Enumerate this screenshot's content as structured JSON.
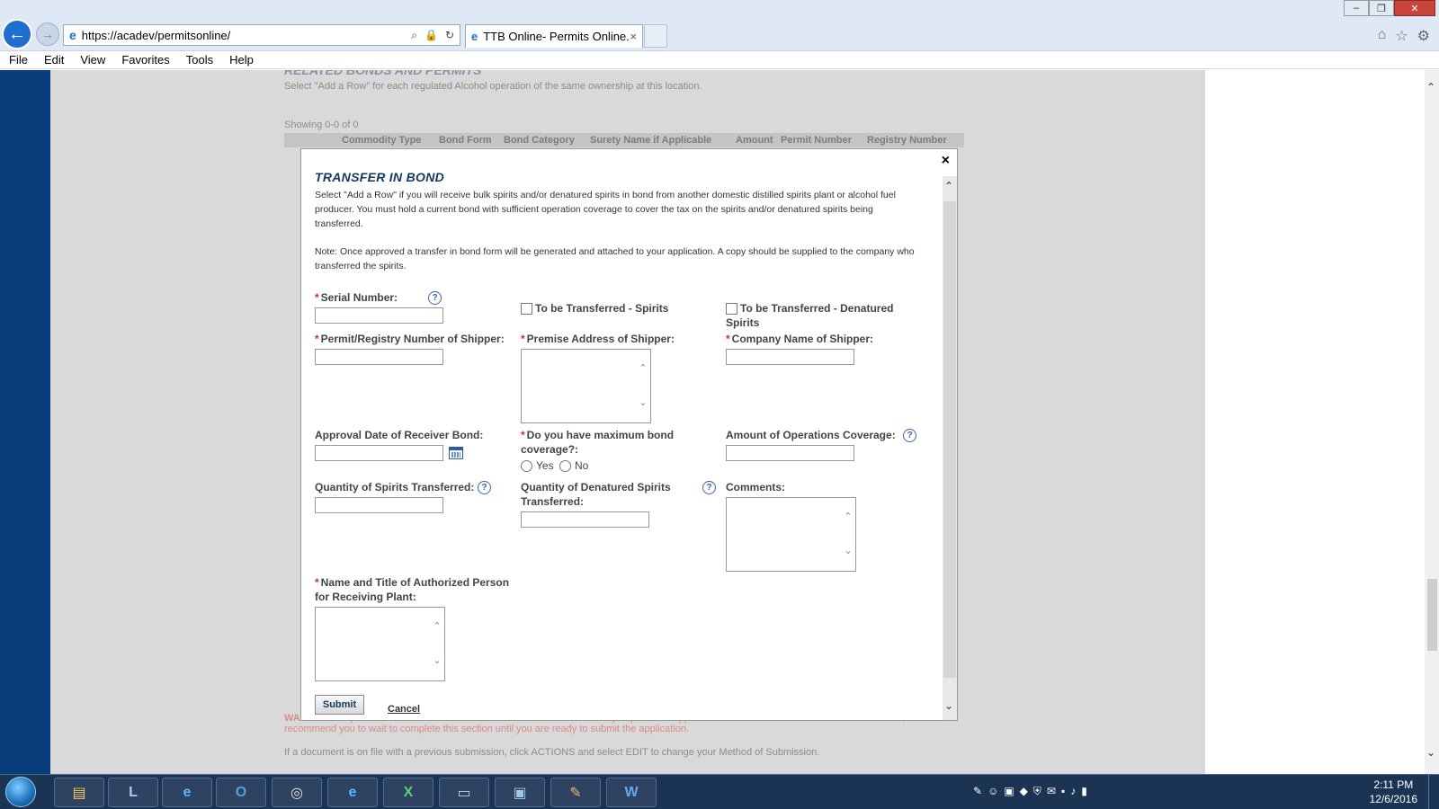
{
  "browser": {
    "url": "https://acadev/permitsonline/",
    "tab_title": "TTB Online- Permits Online...",
    "tab_close": "×",
    "menu": [
      "File",
      "Edit",
      "View",
      "Favorites",
      "Tools",
      "Help"
    ]
  },
  "background_page": {
    "section_heading": "RELATED BONDS AND PERMITS",
    "instruction": "Select \"Add a Row\" for each regulated Alcohol operation of the same ownership at this location.",
    "showing": "Showing 0-0 of 0",
    "table_headers": [
      "Commodity Type",
      "Bond Form",
      "Bond Category",
      "Surety Name if Applicable",
      "Amount",
      "Permit Number",
      "Registry Number"
    ],
    "warning_label": "WARNING:",
    "warning_text": "Any information added within this Section will NOT be saved if you place the application in a Save and Resume Status. Therefore, we recommend you to wait to complete this section until you are ready to submit the application.",
    "footer_text": "If a document is on file with a previous submission, click ACTIONS and select EDIT to change your Method of Submission."
  },
  "modal": {
    "close": "×",
    "title": "TRANSFER IN BOND",
    "description": "Select \"Add a Row\" if you will receive bulk spirits and/or denatured spirits in bond from another domestic distilled spirits plant or alcohol fuel producer. You must hold a current bond with sufficient operation coverage to cover the tax on the spirits and/or denatured spirits being transferred.",
    "note": "Note: Once approved a transfer in bond form will be generated and attached to your application. A copy should be supplied to the company who transferred the spirits.",
    "required_mark": "*",
    "help": "?",
    "fields": {
      "serial_number": "Serial Number:",
      "to_be_transferred_spirits": "To be Transferred - Spirits",
      "to_be_transferred_denatured": "To be Transferred - Denatured Spirits",
      "permit_registry_number": "Permit/Registry Number of Shipper:",
      "premise_address": "Premise Address of Shipper:",
      "company_name": "Company Name of Shipper:",
      "approval_date": "Approval Date of Receiver Bond:",
      "maximum_bond_coverage": "Do you have maximum bond coverage?:",
      "yes": "Yes",
      "no": "No",
      "amount_of_operations_coverage": "Amount of Operations Coverage:",
      "quantity_spirits": "Quantity of Spirits Transferred:",
      "quantity_denatured": "Quantity of Denatured Spirits Transferred:",
      "comments": "Comments:",
      "authorized_person": "Name and Title of Authorized Person for Receiving Plant:"
    },
    "submit": "Submit",
    "cancel": "Cancel"
  },
  "taskbar": {
    "time": "2:11 PM",
    "date": "12/6/2016"
  }
}
